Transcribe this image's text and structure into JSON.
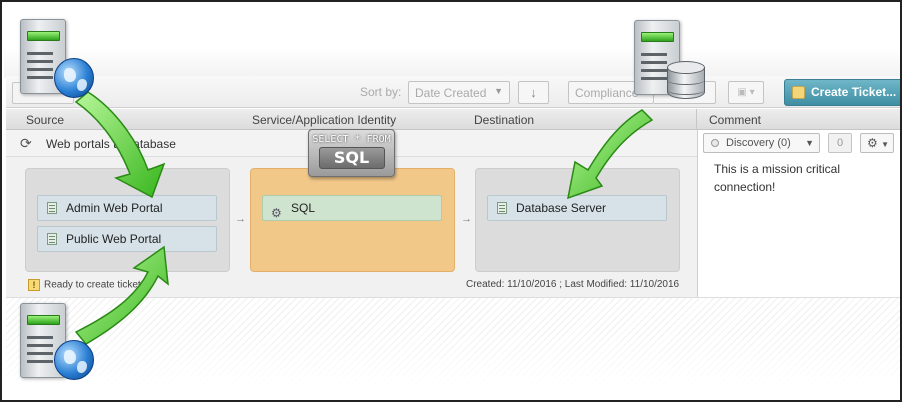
{
  "toolbar": {
    "sort_label": "Sort by:",
    "sort_value": "Date Created",
    "sort_dir_icon": "arrow-down",
    "compliance_label": "Compliance",
    "create_ticket_label": "Create Ticket..."
  },
  "columns": {
    "source": "Source",
    "service": "Service/Application Identity",
    "destination": "Destination",
    "comment": "Comment"
  },
  "connection": {
    "name": "Web portals to database",
    "sources": [
      "Admin Web Portal",
      "Public Web Portal"
    ],
    "service": "SQL",
    "destination": "Database Server",
    "status": "Ready to create ticket",
    "dates": "Created: 11/10/2016 ; Last Modified: 11/10/2016",
    "comment": "This is a mission critical connection!",
    "discovery_label": "Discovery (0)",
    "count": "0"
  },
  "sql_tag": {
    "line1": "SELECT * FROM",
    "line2": "SQL"
  },
  "colors": {
    "accent": "#4a9bb0",
    "service_box": "#f2c889",
    "group_box": "#dcdcdc",
    "item_bg": "#d6e2e8",
    "arrow_green": "#5fd43a"
  },
  "icons": [
    "server-icon",
    "globe-icon",
    "database-icon",
    "refresh-icon",
    "gear-icon",
    "warning-icon",
    "ticket-icon"
  ]
}
